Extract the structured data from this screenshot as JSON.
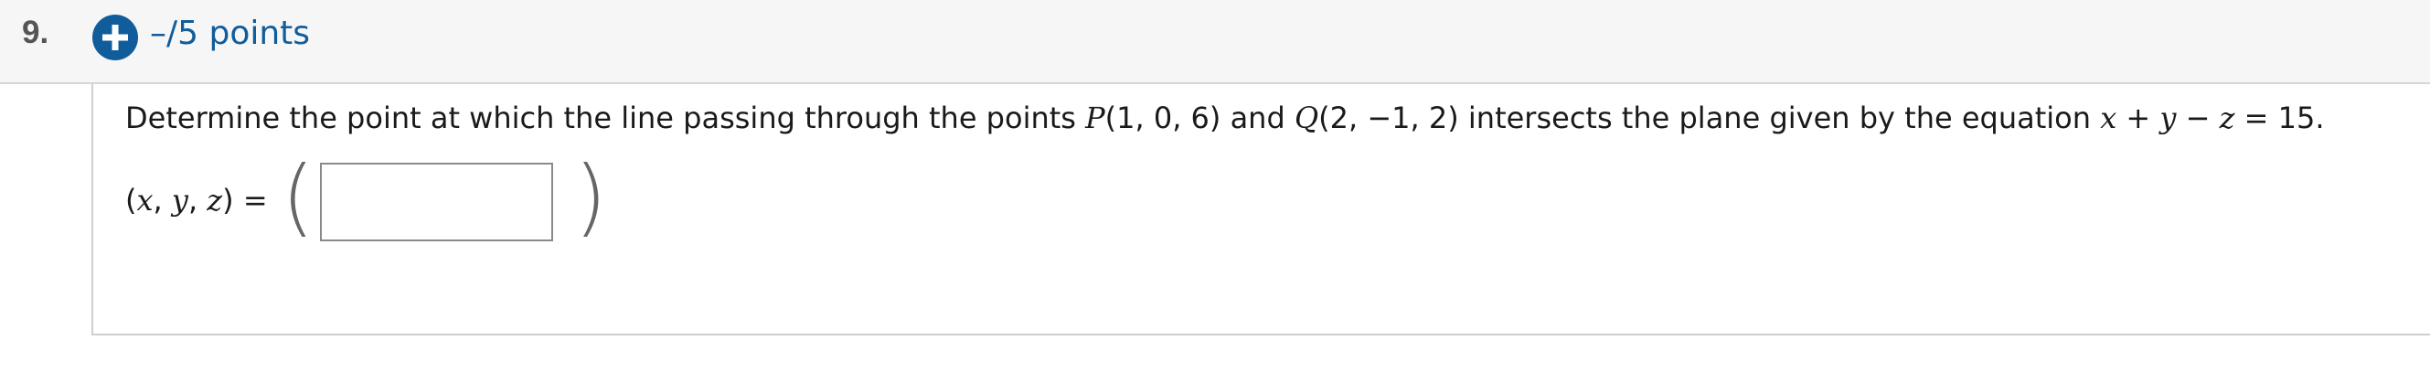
{
  "question": {
    "number": "9.",
    "points": "–/5 points",
    "text_parts": {
      "intro": "Determine the point at which the line passing through the points ",
      "p_name": "P",
      "p_coords": "(1, 0, 6)",
      "and": " and ",
      "q_name": "Q",
      "q_coords": "(2, −1, 2)",
      "middle": " intersects the plane given by the equation ",
      "var_x": "x",
      "plus": " + ",
      "var_y": "y",
      "minus": " − ",
      "var_z": "z",
      "equals": " = 15."
    }
  },
  "answer": {
    "open_paren": "(",
    "var_x": "x",
    "comma1": ", ",
    "var_y": "y",
    "comma2": ", ",
    "var_z": "z",
    "close_paren": ")",
    "equals": " =",
    "big_open": "(",
    "big_close": ")",
    "input_value": "",
    "input_placeholder": ""
  },
  "colors": {
    "accent": "#115d9c",
    "header_bg": "#f6f6f6",
    "text": "#1a1a1a"
  },
  "icons": {
    "add": "plus-circle-icon"
  }
}
